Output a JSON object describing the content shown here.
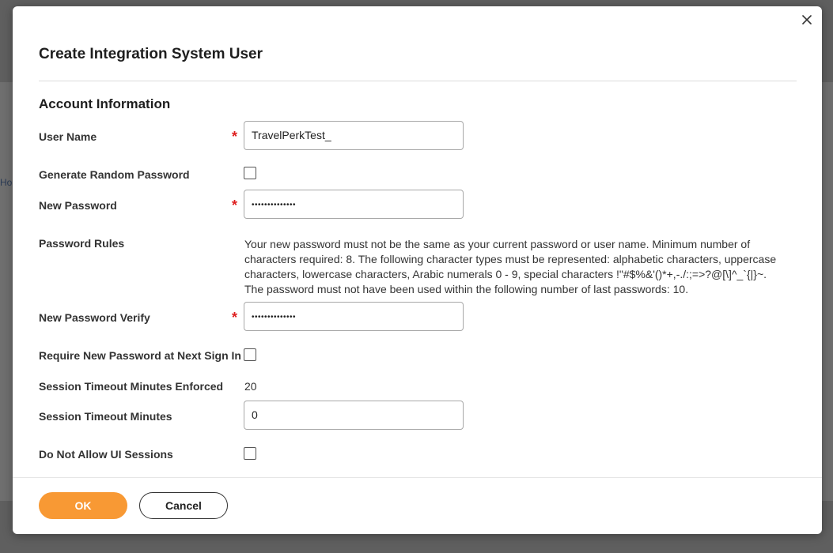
{
  "background": {
    "crumb_text": "Ho"
  },
  "dialog": {
    "title": "Create Integration System User",
    "close_icon": "close-icon",
    "section_title": "Account Information",
    "fields": {
      "user_name": {
        "label": "User Name",
        "required_mark": "*",
        "value": "TravelPerkTest_"
      },
      "generate_random_password": {
        "label": "Generate Random Password",
        "checked": false
      },
      "new_password": {
        "label": "New Password",
        "required_mark": "*",
        "value": "••••••••••••••"
      },
      "password_rules": {
        "label": "Password Rules",
        "text": "Your new password must not be the same as your current password or user name. Minimum number of characters required: 8. The following character types must be represented: alphabetic characters, uppercase characters, lowercase characters, Arabic numerals 0 - 9, special characters !\"#$%&'()*+,-./:;=>?@[\\]^_`{|}~.  The password must not have been used within the following number of last passwords: 10."
      },
      "new_password_verify": {
        "label": "New Password Verify",
        "required_mark": "*",
        "value": "••••••••••••••"
      },
      "require_new_password": {
        "label": "Require New Password at Next Sign In",
        "checked": false
      },
      "session_timeout_enforced": {
        "label": "Session Timeout Minutes Enforced",
        "value": "20"
      },
      "session_timeout_minutes": {
        "label": "Session Timeout Minutes",
        "value": "0"
      },
      "do_not_allow_ui_sessions": {
        "label": "Do Not Allow UI Sessions",
        "checked": false
      }
    },
    "buttons": {
      "ok_label": "OK",
      "cancel_label": "Cancel"
    },
    "colors": {
      "primary_button": "#f89934",
      "required_mark": "#de1f1f"
    }
  }
}
